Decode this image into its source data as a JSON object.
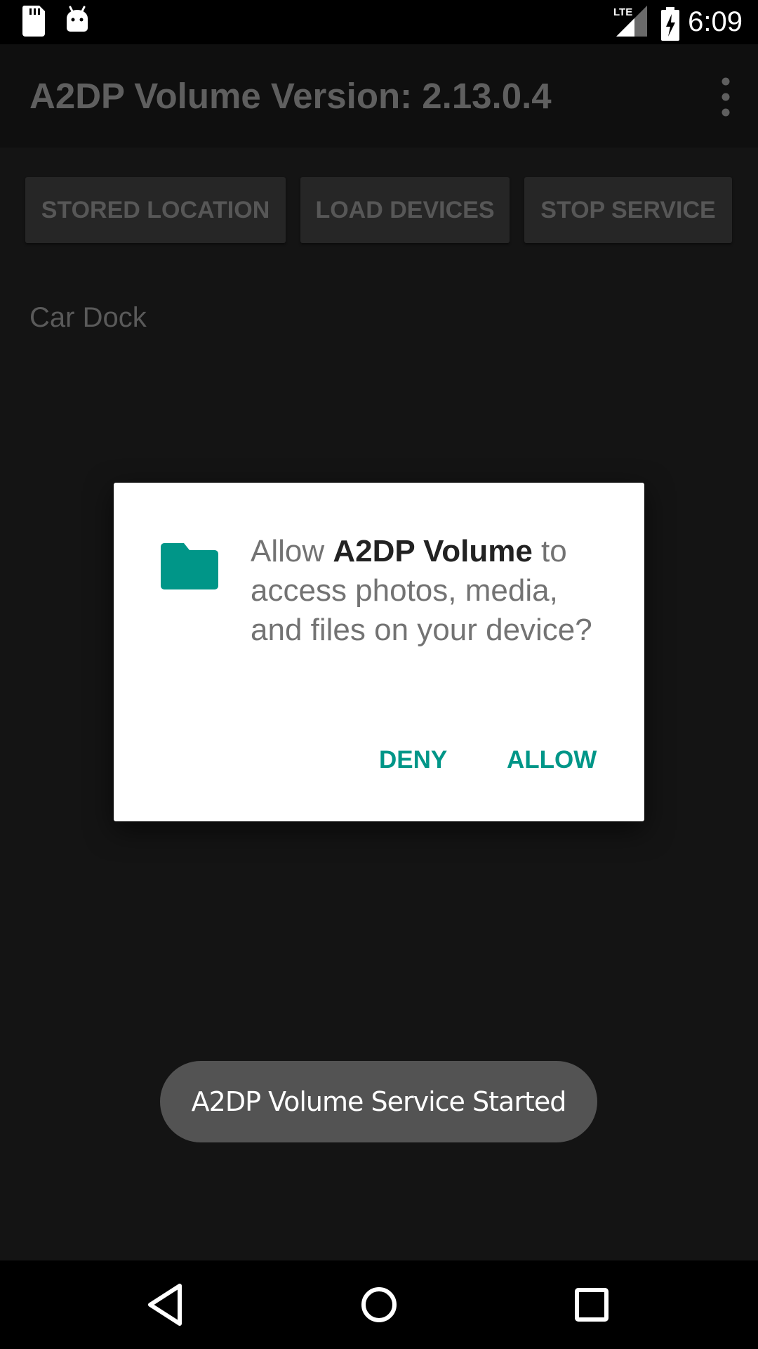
{
  "status_bar": {
    "time": "6:09",
    "network_label": "LTE",
    "icons": [
      "sd-card-icon",
      "android-icon",
      "lte-signal-icon",
      "battery-charging-icon"
    ]
  },
  "app_bar": {
    "title": "A2DP Volume Version: 2.13.0.4",
    "menu_icon": "overflow-menu-icon"
  },
  "buttons": {
    "stored_location": "STORED LOCATION",
    "load_devices": "LOAD DEVICES",
    "stop_service": "STOP SERVICE"
  },
  "devices": [
    {
      "label": "Car Dock"
    }
  ],
  "dialog": {
    "icon": "folder-icon",
    "message_prefix": "Allow ",
    "app_name": "A2DP Volume",
    "message_suffix": " to access photos, media, and files on your device?",
    "deny_label": "DENY",
    "allow_label": "ALLOW"
  },
  "toast": {
    "text": "A2DP Volume Service Started"
  },
  "nav_bar": {
    "icons": [
      "back-icon",
      "home-icon",
      "recent-apps-icon"
    ]
  },
  "colors": {
    "accent": "#009688",
    "background": "#141414",
    "dialog_background": "#ffffff",
    "toast_background": "#535353"
  }
}
